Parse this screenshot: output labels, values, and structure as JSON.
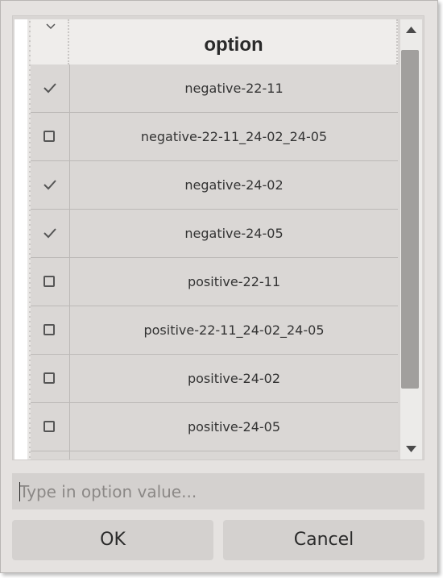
{
  "table": {
    "header": {
      "title": "option"
    },
    "rows": [
      {
        "label": "negative-22-11",
        "checked": true
      },
      {
        "label": "negative-22-11_24-02_24-05",
        "checked": false
      },
      {
        "label": "negative-24-02",
        "checked": true
      },
      {
        "label": "negative-24-05",
        "checked": true
      },
      {
        "label": "positive-22-11",
        "checked": false
      },
      {
        "label": "positive-22-11_24-02_24-05",
        "checked": false
      },
      {
        "label": "positive-24-02",
        "checked": false
      },
      {
        "label": "positive-24-05",
        "checked": false
      }
    ]
  },
  "input": {
    "placeholder": "Type in option value...",
    "value": ""
  },
  "buttons": {
    "ok_label": "OK",
    "cancel_label": "Cancel"
  },
  "icons": {
    "header_toggle": "chevron-down-icon",
    "checked": "checkmark-icon",
    "unchecked": "checkbox-empty-icon",
    "scroll_up": "scroll-up-arrow-icon",
    "scroll_down": "scroll-down-arrow-icon"
  }
}
